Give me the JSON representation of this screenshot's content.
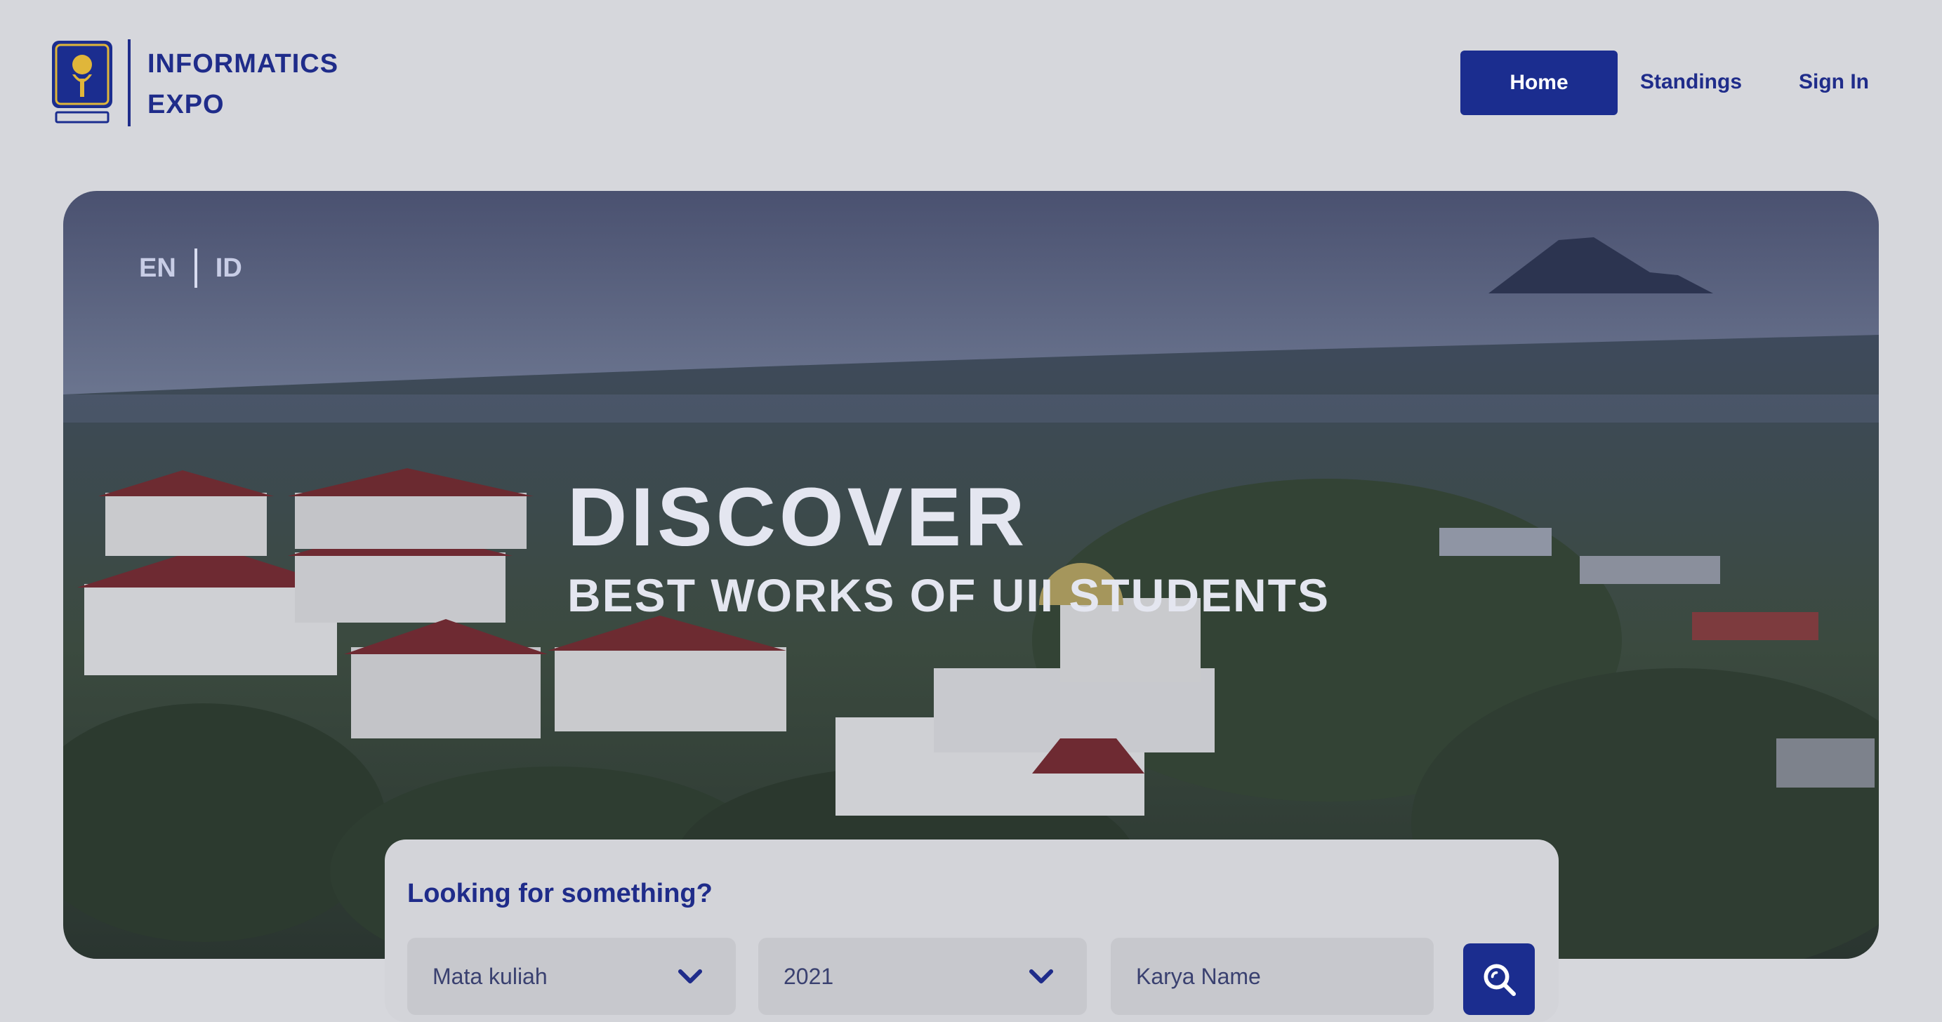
{
  "brand": {
    "line1": "INFORMATICS",
    "line2": "EXPO"
  },
  "nav": {
    "home": "Home",
    "standings": "Standings",
    "sign_in": "Sign In"
  },
  "hero": {
    "lang": {
      "en": "EN",
      "id": "ID"
    },
    "headline": "DISCOVER",
    "subheadline": "BEST WORKS OF UII STUDENTS"
  },
  "search": {
    "title": "Looking for something?",
    "course_value": "Mata kuliah",
    "year_value": "2021",
    "name_placeholder": "Karya Name"
  },
  "colors": {
    "primary": "#1b2d8f",
    "brand_text": "#1f2c8a",
    "logo_gold": "#e0b63a"
  }
}
